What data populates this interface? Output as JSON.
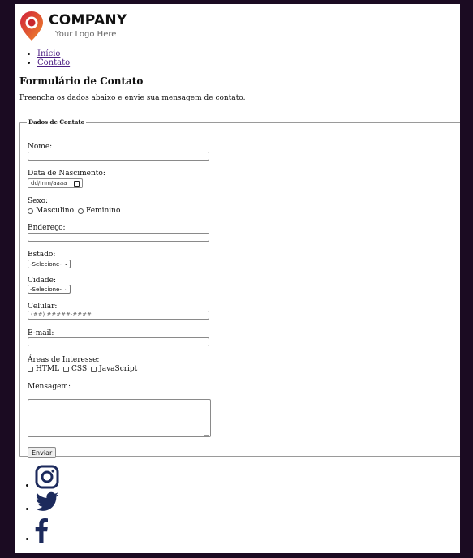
{
  "logo": {
    "company": "COMPANY",
    "tagline": "Your Logo Here"
  },
  "nav": {
    "items": [
      {
        "label": "Início"
      },
      {
        "label": "Contato"
      }
    ]
  },
  "page": {
    "title": "Formulário de Contato",
    "intro": "Preencha os dados abaixo e envie sua mensagem de contato."
  },
  "form": {
    "legend": "Dados de Contato",
    "nome_label": "Nome:",
    "nome_value": "",
    "nascimento_label": "Data de Nascimento:",
    "nascimento_placeholder": "dd/mm/aaaa",
    "sexo_label": "Sexo:",
    "sexo_options": [
      "Masculino",
      "Feminino"
    ],
    "endereco_label": "Endereço:",
    "estado_label": "Estado:",
    "estado_value": "-Selecione-",
    "cidade_label": "Cidade:",
    "cidade_value": "-Selecione-",
    "celular_label": "Celular:",
    "celular_placeholder": "(##) #####-####",
    "email_label": "E-mail:",
    "areas_label": "Áreas de Interesse:",
    "areas_options": [
      "HTML",
      "CSS",
      "JavaScript"
    ],
    "mensagem_label": "Mensagem:",
    "submit_label": "Enviar"
  },
  "social": {
    "items": [
      {
        "icon": "instagram-icon"
      },
      {
        "icon": "twitter-icon"
      },
      {
        "icon": "facebook-icon"
      }
    ]
  },
  "colors": {
    "background": "#1b0b22",
    "logo_red": "#c8262e",
    "logo_orange": "#f08a2c",
    "social_navy": "#1c2a5c",
    "link": "#4b1c82"
  }
}
